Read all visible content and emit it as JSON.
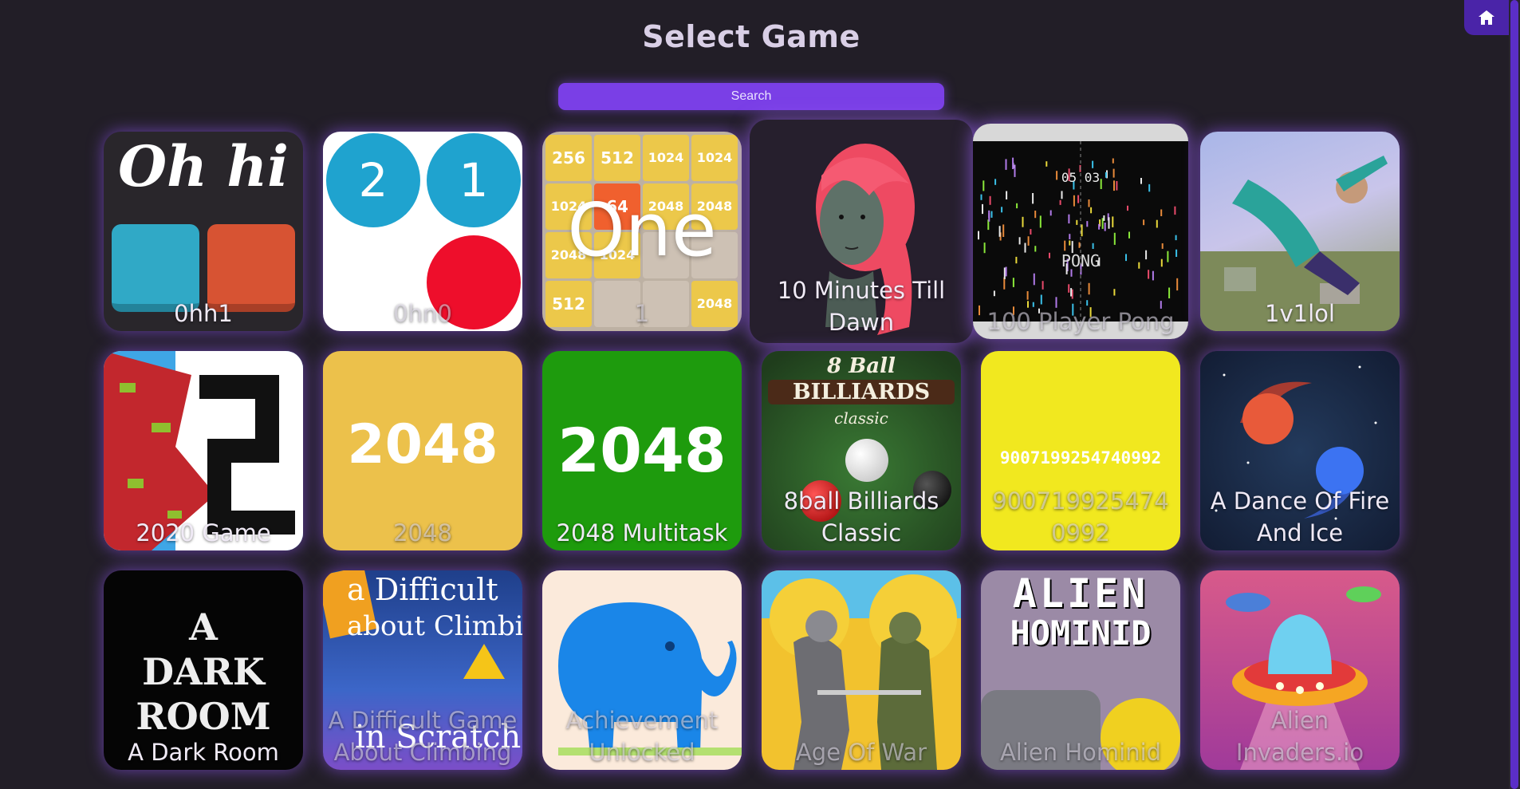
{
  "header": {
    "title": "Select Game"
  },
  "search": {
    "placeholder": "Search"
  },
  "nav": {
    "home_icon": "home-icon"
  },
  "colors": {
    "background": "#221e27",
    "accent": "#7a3fe6",
    "glow": "#9a5cff"
  },
  "games": [
    {
      "label": "0hh1",
      "art_text": "Oh hi"
    },
    {
      "label": "0hn0",
      "art_numbers": [
        "2",
        "1"
      ]
    },
    {
      "label": "1",
      "art_text": "One",
      "grid": [
        "256",
        "512",
        "1024",
        "1024",
        "1024",
        "64",
        "2048",
        "2048",
        "2048",
        "1024",
        "",
        "",
        "512",
        "",
        "",
        "2048"
      ]
    },
    {
      "label": "10 Minutes Till Dawn"
    },
    {
      "label": "100 Player Pong",
      "art_score": "05 03",
      "art_text": "PONG"
    },
    {
      "label": "1v1lol"
    },
    {
      "label": "2020 Game",
      "art_text": "2"
    },
    {
      "label": "2048",
      "art_text": "2048"
    },
    {
      "label": "2048 Multitask",
      "art_text": "2048"
    },
    {
      "label": "8ball Billiards Classic",
      "art_lines": [
        "8 Ball",
        "BILLIARDS",
        "classic"
      ]
    },
    {
      "label": "9007199254740992",
      "art_text": "9007199254740992"
    },
    {
      "label": "A Dance Of Fire And Ice"
    },
    {
      "label": "A Dark Room",
      "art_lines": [
        "A",
        "DARK",
        "ROOM"
      ]
    },
    {
      "label": "A Difficult Game About Climbing",
      "art_lines": [
        "a Difficult",
        "about Climbing",
        "in Scratch"
      ]
    },
    {
      "label": "Achievement Unlocked"
    },
    {
      "label": "Age Of War"
    },
    {
      "label": "Alien Hominid",
      "art_lines": [
        "ALIEN",
        "HOMINID"
      ]
    },
    {
      "label": "Alien Invaders.io"
    }
  ]
}
